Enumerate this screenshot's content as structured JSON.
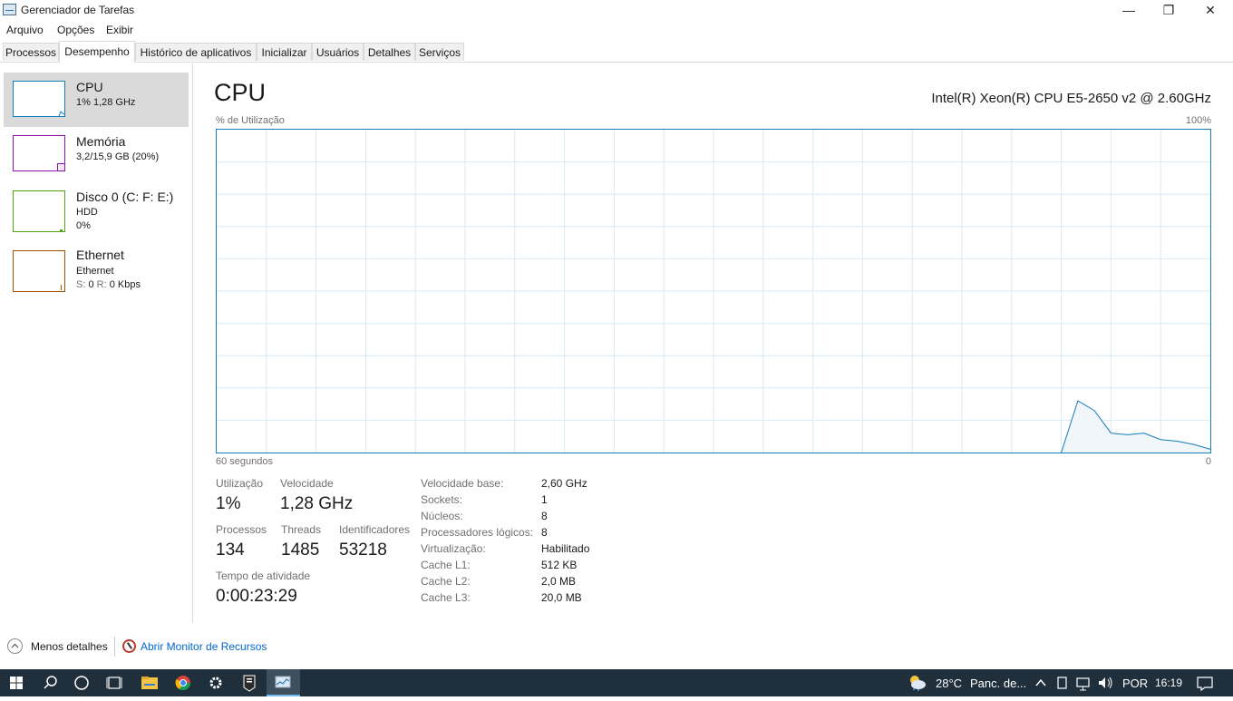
{
  "window": {
    "title": "Gerenciador de Tarefas",
    "minimize_symbol": "—",
    "maximize_symbol": "❐",
    "close_symbol": "✕"
  },
  "menu": [
    "Arquivo",
    "Opções",
    "Exibir"
  ],
  "tabs": [
    "Processos",
    "Desempenho",
    "Histórico de aplicativos",
    "Inicializar",
    "Usuários",
    "Detalhes",
    "Serviços"
  ],
  "active_tab": "Desempenho",
  "sidebar": {
    "items": [
      {
        "title": "CPU",
        "sub1": "1% 1,28 GHz",
        "sub2": "",
        "color": "#117dbb"
      },
      {
        "title": "Memória",
        "sub1": "3,2/15,9 GB (20%)",
        "sub2": "",
        "color": "#8b12ae"
      },
      {
        "title": "Disco 0 (C: F: E:)",
        "sub1": "HDD",
        "sub2": "0%",
        "color": "#4da60c"
      },
      {
        "title": "Ethernet",
        "sub1": "Ethernet",
        "sub2_s": "S:",
        "sub2_s_val": "0",
        "sub2_r": "R:",
        "sub2_r_val": "0 Kbps",
        "color": "#a74f01"
      }
    ]
  },
  "main": {
    "title": "CPU",
    "model": "Intel(R) Xeon(R) CPU E5-2650 v2 @ 2.60GHz",
    "y_label": "% de Utilização",
    "y_max_label": "100%",
    "x_left_label": "60 segundos",
    "x_right_label": "0",
    "stats": {
      "utilizacao_label": "Utilização",
      "utilizacao_value": "1%",
      "velocidade_label": "Velocidade",
      "velocidade_value": "1,28 GHz",
      "processos_label": "Processos",
      "processos_value": "134",
      "threads_label": "Threads",
      "threads_value": "1485",
      "identificadores_label": "Identificadores",
      "identificadores_value": "53218",
      "tempo_label": "Tempo de atividade",
      "tempo_value": "0:00:23:29"
    },
    "info": [
      {
        "key": "Velocidade base:",
        "value": "2,60 GHz"
      },
      {
        "key": "Sockets:",
        "value": "1"
      },
      {
        "key": "Núcleos:",
        "value": "8"
      },
      {
        "key": "Processadores lógicos:",
        "value": "8"
      },
      {
        "key": "Virtualização:",
        "value": "Habilitado"
      },
      {
        "key": "Cache L1:",
        "value": "512 KB"
      },
      {
        "key": "Cache L2:",
        "value": "2,0 MB"
      },
      {
        "key": "Cache L3:",
        "value": "20,0 MB"
      }
    ]
  },
  "chart_data": {
    "type": "area",
    "x": [
      60,
      59,
      58,
      57,
      56,
      55,
      54,
      53,
      52,
      51,
      50,
      49,
      48,
      47,
      46,
      45,
      44,
      43,
      42,
      41,
      40,
      39,
      38,
      37,
      36,
      35,
      34,
      33,
      32,
      31,
      30,
      29,
      28,
      27,
      26,
      25,
      24,
      23,
      22,
      21,
      20,
      19,
      18,
      17,
      16,
      15,
      14,
      13,
      12,
      11,
      10,
      9,
      8,
      7,
      6,
      5,
      4,
      3,
      2,
      1,
      0
    ],
    "values": [
      0,
      0,
      0,
      0,
      0,
      0,
      0,
      0,
      0,
      0,
      0,
      0,
      0,
      0,
      0,
      0,
      0,
      0,
      0,
      0,
      0,
      0,
      0,
      0,
      0,
      0,
      0,
      0,
      0,
      0,
      0,
      0,
      0,
      0,
      0,
      0,
      0,
      0,
      0,
      0,
      0,
      0,
      0,
      0,
      0,
      0,
      0,
      0,
      0,
      0,
      0,
      0,
      16,
      13,
      6,
      5.5,
      6,
      4,
      3.5,
      2.5,
      1
    ],
    "xlabel": "60 segundos",
    "ylabel": "% de Utilização",
    "ylim": [
      0,
      100
    ],
    "xlim": [
      60,
      0
    ],
    "grid": true,
    "line_color": "#117dbb",
    "fill_color": "#f1f6fa"
  },
  "footer": {
    "less_details": "Menos detalhes",
    "open_monitor": "Abrir Monitor de Recursos"
  },
  "taskbar": {
    "temperature": "28°C",
    "weather": "Panc. de...",
    "language": "POR",
    "time": "16:19"
  }
}
